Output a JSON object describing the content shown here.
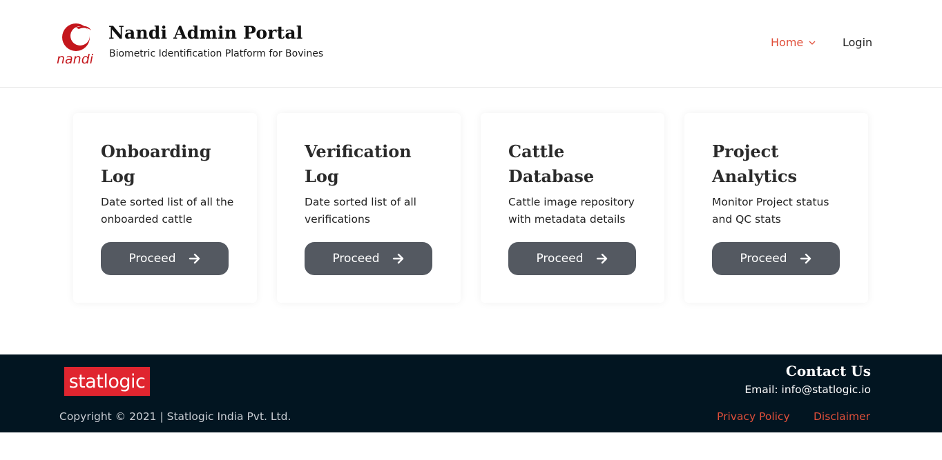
{
  "header": {
    "title": "Nandi Admin Portal",
    "subtitle": "Biometric Identification Platform for Bovines",
    "logo_text": "nandi",
    "nav": {
      "home_label": "Home",
      "login_label": "Login"
    }
  },
  "cards": [
    {
      "title_line1": "Onboarding",
      "title_line2": "Log",
      "description": "Date sorted list of all the onboarded cattle",
      "button_label": "Proceed"
    },
    {
      "title_line1": "Verification",
      "title_line2": "Log",
      "description": "Date sorted list of all verifications",
      "button_label": "Proceed"
    },
    {
      "title_line1": "Cattle",
      "title_line2": "Database",
      "description": "Cattle image repository with metadata details",
      "button_label": "Proceed"
    },
    {
      "title_line1": "Project",
      "title_line2": "Analytics",
      "description": "Monitor Project status and QC stats",
      "button_label": "Proceed"
    }
  ],
  "footer": {
    "brand": "statlogic",
    "copyright": "Copyright © 2021 | Statlogic India Pvt. Ltd.",
    "contact_title": "Contact Us",
    "contact_email": "Email: info@statlogic.io",
    "links": {
      "privacy": "Privacy Policy",
      "disclaimer": "Disclaimer"
    }
  },
  "colors": {
    "accent": "#e04f3a",
    "button": "#545961",
    "footer_bg": "#021521",
    "brand_red": "#e0252f"
  },
  "icons": {
    "nav_dropdown": "chevron-down-icon",
    "button": "arrow-right-icon",
    "logo": "nandi-logo-icon"
  }
}
